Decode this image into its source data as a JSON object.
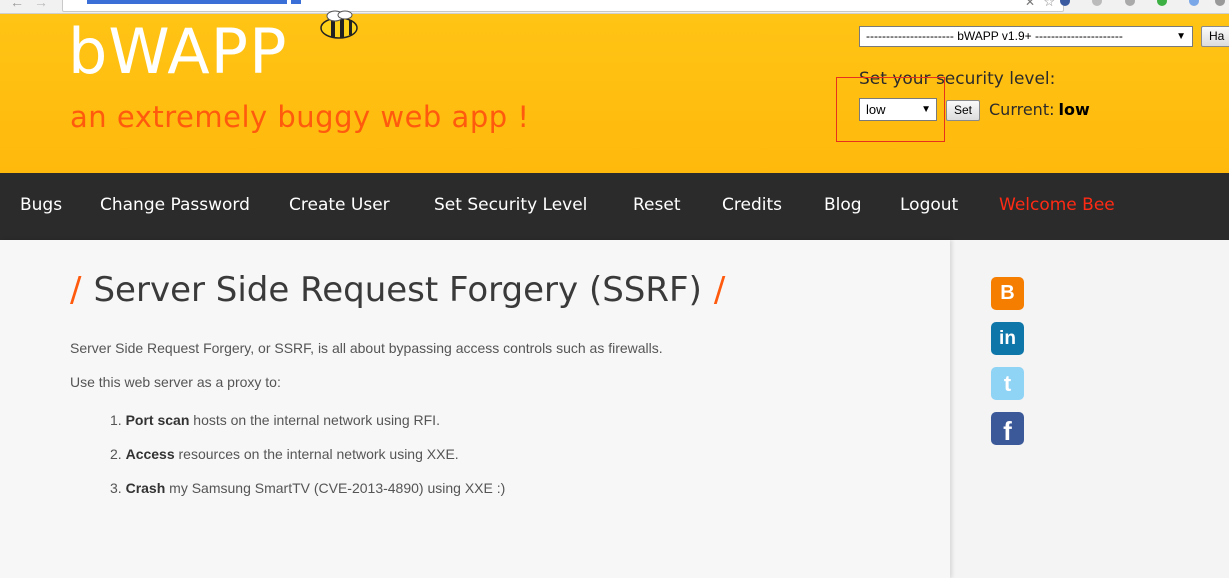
{
  "header": {
    "logo": "bWAPP",
    "tagline": "an extremely buggy web app !",
    "app_select_value": "---------------------- bWAPP v1.9+ ----------------------",
    "hack_button": "Ha",
    "security_label": "Set your security level:",
    "security_select_value": "low",
    "set_button": "Set",
    "current_label": "Current:",
    "current_value": "low"
  },
  "nav": {
    "items": [
      "Bugs",
      "Change Password",
      "Create User",
      "Set Security Level",
      "Reset",
      "Credits",
      "Blog",
      "Logout"
    ],
    "welcome": "Welcome Bee"
  },
  "main": {
    "title": "Server Side Request Forgery (SSRF)",
    "intro": "Server Side Request Forgery, or SSRF, is all about bypassing access controls such as firewalls.",
    "proxy_text": "Use this web server as a proxy to:",
    "list": [
      {
        "num": "1.",
        "bold": "Port scan",
        "rest": " hosts on the internal network using RFI."
      },
      {
        "num": "2.",
        "bold": "Access",
        "rest": " resources on the internal network using XXE."
      },
      {
        "num": "3.",
        "bold": "Crash",
        "rest": " my Samsung SmartTV (CVE-2013-4890) using XXE :)"
      }
    ]
  },
  "social": {
    "blogger_icon": "blogger-icon",
    "linkedin_icon": "linkedin-icon",
    "twitter_icon": "twitter-icon",
    "facebook_icon": "facebook-icon",
    "blogger_glyph": "B",
    "linkedin_glyph": "in",
    "twitter_glyph": "t",
    "facebook_glyph": "f"
  },
  "colors": {
    "header_bg": "#ffbc10",
    "tagline": "#ff5a0d",
    "nav_bg": "#2b2b2b",
    "welcome": "#ff2a14",
    "highlight_box": "#e8301e"
  }
}
